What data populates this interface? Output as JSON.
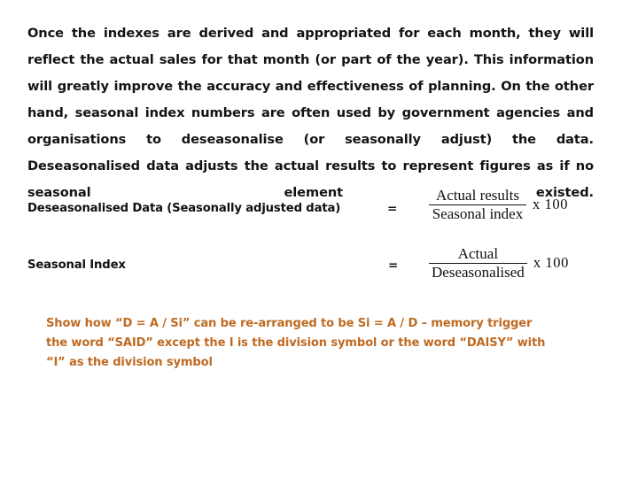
{
  "document": {
    "background_color": "#ffffff",
    "body_text_color": "#131313",
    "annotation_color": "#bf6a22"
  },
  "intro": {
    "paragraph": "Once the indexes are derived and appropriated for each month, they will reflect the actual sales for that month (or part of the year). This information will greatly improve the accuracy and effectiveness of planning. On the other hand, seasonal index numbers are often used by government agencies and organisations to deseasonalise (or seasonally adjust) the data. Deseasonalised data adjusts the actual results to represent figures as if no seasonal element existed."
  },
  "formulas": [
    {
      "label": "Deseasonalised Data (Seasonally adjusted data)",
      "equals": "=",
      "numerator": "Actual results",
      "denominator": "Seasonal index",
      "multiplier": "x 100"
    },
    {
      "label": "Seasonal Index",
      "equals": "=",
      "numerator": "Actual",
      "denominator": "Deseasonalised",
      "multiplier": "x 100"
    }
  ],
  "annotation": {
    "line1": "Show how  “D = A / Si” can be re-arranged to be Si = A / D – memory trigger",
    "line2": "the word “SAID” except the I is the division symbol or the word “DAISY” with",
    "line3": "“I” as the division symbol"
  }
}
